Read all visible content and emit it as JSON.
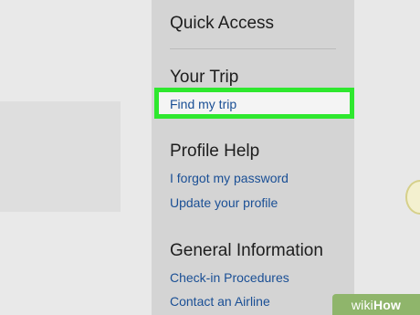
{
  "quick_access": {
    "title": "Quick Access"
  },
  "your_trip": {
    "title": "Your Trip",
    "links": [
      "Find my trip"
    ]
  },
  "profile_help": {
    "title": "Profile Help",
    "links": [
      "I forgot my password",
      "Update your profile"
    ]
  },
  "general_information": {
    "title": "General Information",
    "links": [
      "Check-in Procedures",
      "Contact an Airline"
    ]
  },
  "watermark": {
    "wiki": "wiki",
    "how": "How"
  },
  "colors": {
    "highlight": "#2ee82e",
    "link": "#1a4f95",
    "panel": "#d4d4d4"
  }
}
